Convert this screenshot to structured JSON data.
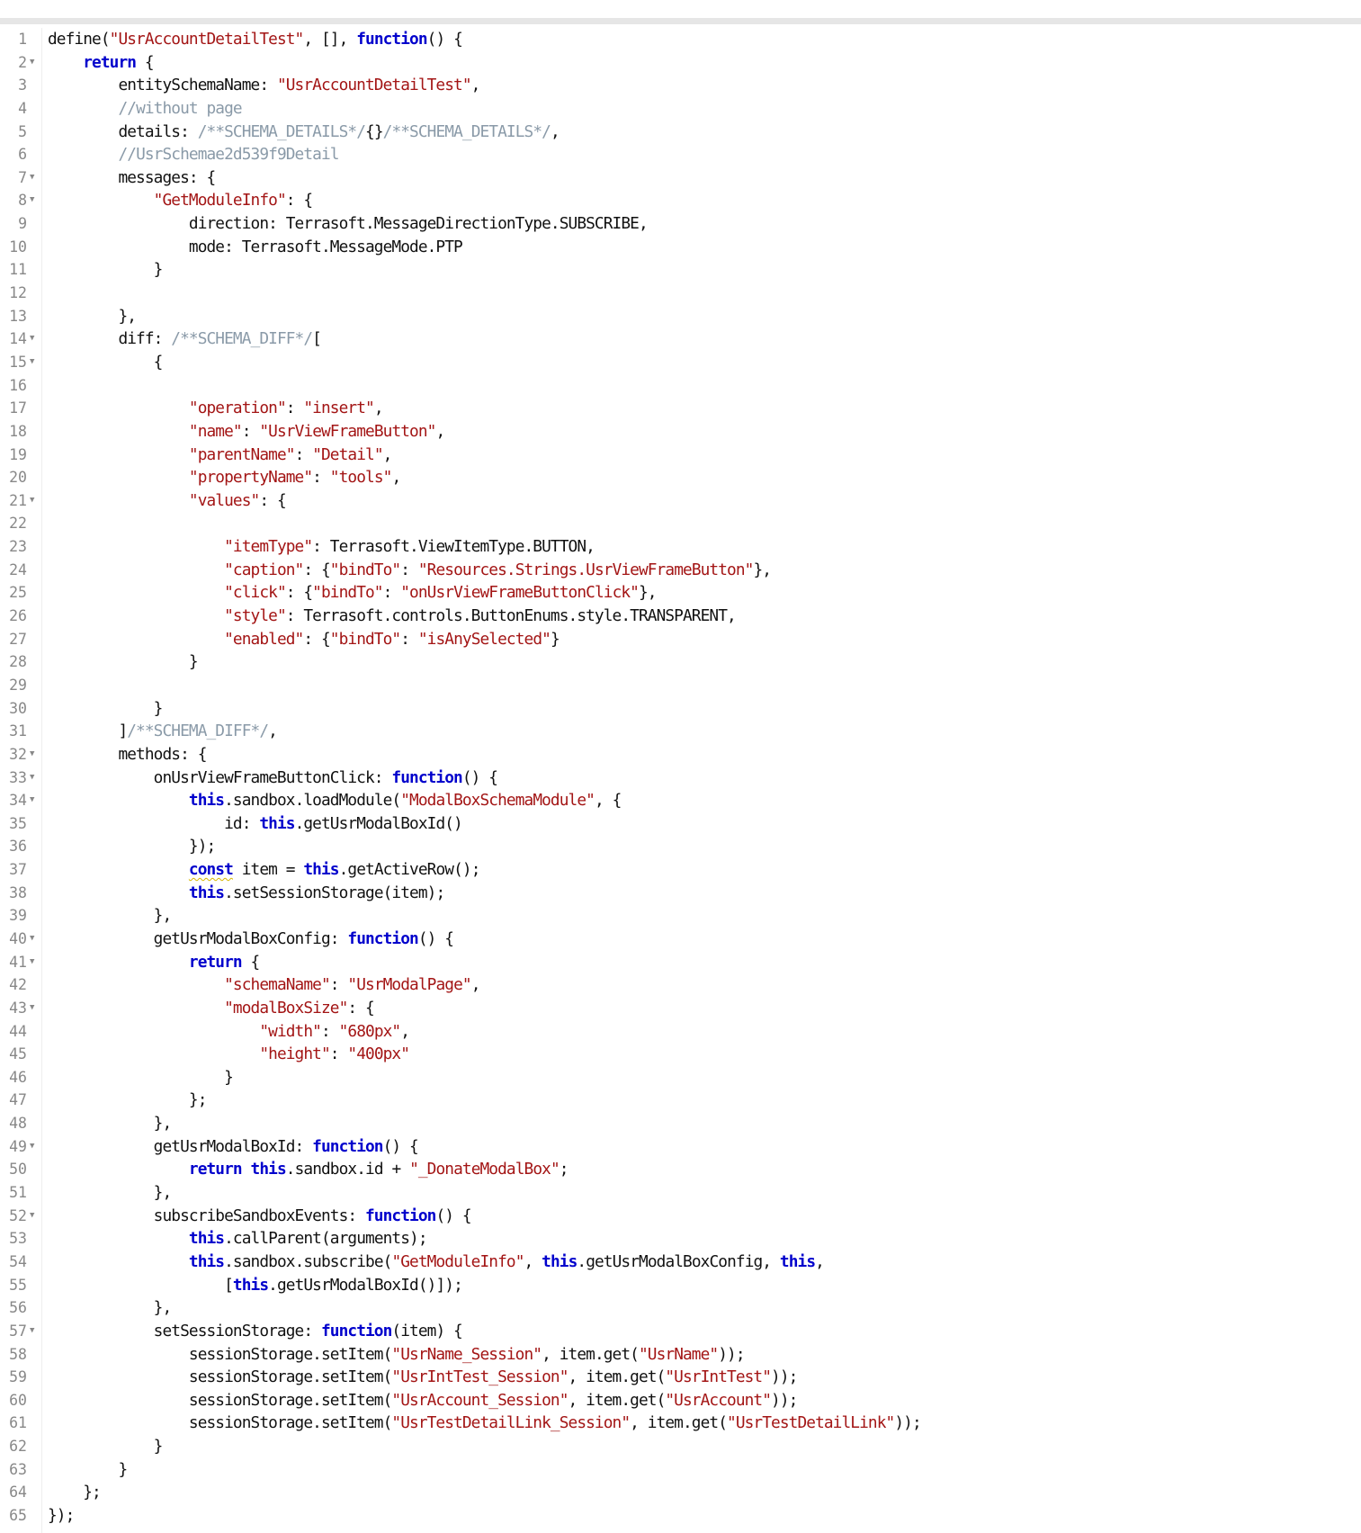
{
  "colors": {
    "keyword": "#0000cc",
    "string": "#a31515",
    "comment": "#8a9aa8",
    "text": "#111111",
    "line_number": "#888888",
    "top_bar": "#e6e6e6"
  },
  "lines": [
    {
      "n": "1",
      "fold": false,
      "tokens": [
        [
          "p",
          "define("
        ],
        [
          "s",
          "\"UsrAccountDetailTest\""
        ],
        [
          "p",
          ", [], "
        ],
        [
          "k",
          "function"
        ],
        [
          "p",
          "() {"
        ]
      ]
    },
    {
      "n": "2",
      "fold": true,
      "tokens": [
        [
          "p",
          "    "
        ],
        [
          "k",
          "return"
        ],
        [
          "p",
          " {"
        ]
      ]
    },
    {
      "n": "3",
      "fold": false,
      "tokens": [
        [
          "p",
          "        entitySchemaName: "
        ],
        [
          "s",
          "\"UsrAccountDetailTest\""
        ],
        [
          "p",
          ","
        ]
      ]
    },
    {
      "n": "4",
      "fold": false,
      "tokens": [
        [
          "p",
          "        "
        ],
        [
          "c",
          "//without page"
        ]
      ]
    },
    {
      "n": "5",
      "fold": false,
      "tokens": [
        [
          "p",
          "        details: "
        ],
        [
          "c",
          "/**SCHEMA_DETAILS*/"
        ],
        [
          "p",
          "{}"
        ],
        [
          "c",
          "/**SCHEMA_DETAILS*/"
        ],
        [
          "p",
          ","
        ]
      ]
    },
    {
      "n": "6",
      "fold": false,
      "tokens": [
        [
          "p",
          "        "
        ],
        [
          "c",
          "//UsrSchemae2d539f9Detail"
        ]
      ]
    },
    {
      "n": "7",
      "fold": true,
      "tokens": [
        [
          "p",
          "        messages: {"
        ]
      ]
    },
    {
      "n": "8",
      "fold": true,
      "tokens": [
        [
          "p",
          "            "
        ],
        [
          "s",
          "\"GetModuleInfo\""
        ],
        [
          "p",
          ": {"
        ]
      ]
    },
    {
      "n": "9",
      "fold": false,
      "tokens": [
        [
          "p",
          "                direction: Terrasoft.MessageDirectionType.SUBSCRIBE,"
        ]
      ]
    },
    {
      "n": "10",
      "fold": false,
      "tokens": [
        [
          "p",
          "                mode: Terrasoft.MessageMode.PTP"
        ]
      ]
    },
    {
      "n": "11",
      "fold": false,
      "tokens": [
        [
          "p",
          "            }"
        ]
      ]
    },
    {
      "n": "12",
      "fold": false,
      "tokens": [
        [
          "p",
          ""
        ]
      ]
    },
    {
      "n": "13",
      "fold": false,
      "tokens": [
        [
          "p",
          "        },"
        ]
      ]
    },
    {
      "n": "14",
      "fold": true,
      "tokens": [
        [
          "p",
          "        diff: "
        ],
        [
          "c",
          "/**SCHEMA_DIFF*/"
        ],
        [
          "p",
          "["
        ]
      ]
    },
    {
      "n": "15",
      "fold": true,
      "tokens": [
        [
          "p",
          "            {"
        ]
      ]
    },
    {
      "n": "16",
      "fold": false,
      "tokens": [
        [
          "p",
          ""
        ]
      ]
    },
    {
      "n": "17",
      "fold": false,
      "tokens": [
        [
          "p",
          "                "
        ],
        [
          "s",
          "\"operation\""
        ],
        [
          "p",
          ": "
        ],
        [
          "s",
          "\"insert\""
        ],
        [
          "p",
          ","
        ]
      ]
    },
    {
      "n": "18",
      "fold": false,
      "tokens": [
        [
          "p",
          "                "
        ],
        [
          "s",
          "\"name\""
        ],
        [
          "p",
          ": "
        ],
        [
          "s",
          "\"UsrViewFrameButton\""
        ],
        [
          "p",
          ","
        ]
      ]
    },
    {
      "n": "19",
      "fold": false,
      "tokens": [
        [
          "p",
          "                "
        ],
        [
          "s",
          "\"parentName\""
        ],
        [
          "p",
          ": "
        ],
        [
          "s",
          "\"Detail\""
        ],
        [
          "p",
          ","
        ]
      ]
    },
    {
      "n": "20",
      "fold": false,
      "tokens": [
        [
          "p",
          "                "
        ],
        [
          "s",
          "\"propertyName\""
        ],
        [
          "p",
          ": "
        ],
        [
          "s",
          "\"tools\""
        ],
        [
          "p",
          ","
        ]
      ]
    },
    {
      "n": "21",
      "fold": true,
      "tokens": [
        [
          "p",
          "                "
        ],
        [
          "s",
          "\"values\""
        ],
        [
          "p",
          ": {"
        ]
      ]
    },
    {
      "n": "22",
      "fold": false,
      "tokens": [
        [
          "p",
          ""
        ]
      ]
    },
    {
      "n": "23",
      "fold": false,
      "tokens": [
        [
          "p",
          "                    "
        ],
        [
          "s",
          "\"itemType\""
        ],
        [
          "p",
          ": Terrasoft.ViewItemType.BUTTON,"
        ]
      ]
    },
    {
      "n": "24",
      "fold": false,
      "tokens": [
        [
          "p",
          "                    "
        ],
        [
          "s",
          "\"caption\""
        ],
        [
          "p",
          ": {"
        ],
        [
          "s",
          "\"bindTo\""
        ],
        [
          "p",
          ": "
        ],
        [
          "s",
          "\"Resources.Strings.UsrViewFrameButton\""
        ],
        [
          "p",
          "},"
        ]
      ]
    },
    {
      "n": "25",
      "fold": false,
      "tokens": [
        [
          "p",
          "                    "
        ],
        [
          "s",
          "\"click\""
        ],
        [
          "p",
          ": {"
        ],
        [
          "s",
          "\"bindTo\""
        ],
        [
          "p",
          ": "
        ],
        [
          "s",
          "\"onUsrViewFrameButtonClick\""
        ],
        [
          "p",
          "},"
        ]
      ]
    },
    {
      "n": "26",
      "fold": false,
      "tokens": [
        [
          "p",
          "                    "
        ],
        [
          "s",
          "\"style\""
        ],
        [
          "p",
          ": Terrasoft.controls.ButtonEnums.style.TRANSPARENT,"
        ]
      ]
    },
    {
      "n": "27",
      "fold": false,
      "tokens": [
        [
          "p",
          "                    "
        ],
        [
          "s",
          "\"enabled\""
        ],
        [
          "p",
          ": {"
        ],
        [
          "s",
          "\"bindTo\""
        ],
        [
          "p",
          ": "
        ],
        [
          "s",
          "\"isAnySelected\""
        ],
        [
          "p",
          "}"
        ]
      ]
    },
    {
      "n": "28",
      "fold": false,
      "tokens": [
        [
          "p",
          "                }"
        ]
      ]
    },
    {
      "n": "29",
      "fold": false,
      "tokens": [
        [
          "p",
          ""
        ]
      ]
    },
    {
      "n": "30",
      "fold": false,
      "tokens": [
        [
          "p",
          "            }"
        ]
      ]
    },
    {
      "n": "31",
      "fold": false,
      "tokens": [
        [
          "p",
          "        ]"
        ],
        [
          "c",
          "/**SCHEMA_DIFF*/"
        ],
        [
          "p",
          ","
        ]
      ]
    },
    {
      "n": "32",
      "fold": true,
      "tokens": [
        [
          "p",
          "        methods: {"
        ]
      ]
    },
    {
      "n": "33",
      "fold": true,
      "tokens": [
        [
          "p",
          "            onUsrViewFrameButtonClick: "
        ],
        [
          "k",
          "function"
        ],
        [
          "p",
          "() {"
        ]
      ]
    },
    {
      "n": "34",
      "fold": true,
      "tokens": [
        [
          "p",
          "                "
        ],
        [
          "k",
          "this"
        ],
        [
          "p",
          ".sandbox.loadModule("
        ],
        [
          "s",
          "\"ModalBoxSchemaModule\""
        ],
        [
          "p",
          ", {"
        ]
      ]
    },
    {
      "n": "35",
      "fold": false,
      "tokens": [
        [
          "p",
          "                    id: "
        ],
        [
          "k",
          "this"
        ],
        [
          "p",
          ".getUsrModalBoxId()"
        ]
      ]
    },
    {
      "n": "36",
      "fold": false,
      "tokens": [
        [
          "p",
          "                });"
        ]
      ]
    },
    {
      "n": "37",
      "fold": false,
      "tokens": [
        [
          "p",
          "                "
        ],
        [
          "kc",
          "const"
        ],
        [
          "p",
          " item = "
        ],
        [
          "k",
          "this"
        ],
        [
          "p",
          ".getActiveRow();"
        ]
      ]
    },
    {
      "n": "38",
      "fold": false,
      "tokens": [
        [
          "p",
          "                "
        ],
        [
          "k",
          "this"
        ],
        [
          "p",
          ".setSessionStorage(item);"
        ]
      ]
    },
    {
      "n": "39",
      "fold": false,
      "tokens": [
        [
          "p",
          "            },"
        ]
      ]
    },
    {
      "n": "40",
      "fold": true,
      "tokens": [
        [
          "p",
          "            getUsrModalBoxConfig: "
        ],
        [
          "k",
          "function"
        ],
        [
          "p",
          "() {"
        ]
      ]
    },
    {
      "n": "41",
      "fold": true,
      "tokens": [
        [
          "p",
          "                "
        ],
        [
          "k",
          "return"
        ],
        [
          "p",
          " {"
        ]
      ]
    },
    {
      "n": "42",
      "fold": false,
      "tokens": [
        [
          "p",
          "                    "
        ],
        [
          "s",
          "\"schemaName\""
        ],
        [
          "p",
          ": "
        ],
        [
          "s",
          "\"UsrModalPage\""
        ],
        [
          "p",
          ","
        ]
      ]
    },
    {
      "n": "43",
      "fold": true,
      "tokens": [
        [
          "p",
          "                    "
        ],
        [
          "s",
          "\"modalBoxSize\""
        ],
        [
          "p",
          ": {"
        ]
      ]
    },
    {
      "n": "44",
      "fold": false,
      "tokens": [
        [
          "p",
          "                        "
        ],
        [
          "s",
          "\"width\""
        ],
        [
          "p",
          ": "
        ],
        [
          "s",
          "\"680px\""
        ],
        [
          "p",
          ","
        ]
      ]
    },
    {
      "n": "45",
      "fold": false,
      "tokens": [
        [
          "p",
          "                        "
        ],
        [
          "s",
          "\"height\""
        ],
        [
          "p",
          ": "
        ],
        [
          "s",
          "\"400px\""
        ]
      ]
    },
    {
      "n": "46",
      "fold": false,
      "tokens": [
        [
          "p",
          "                    }"
        ]
      ]
    },
    {
      "n": "47",
      "fold": false,
      "tokens": [
        [
          "p",
          "                };"
        ]
      ]
    },
    {
      "n": "48",
      "fold": false,
      "tokens": [
        [
          "p",
          "            },"
        ]
      ]
    },
    {
      "n": "49",
      "fold": true,
      "tokens": [
        [
          "p",
          "            getUsrModalBoxId: "
        ],
        [
          "k",
          "function"
        ],
        [
          "p",
          "() {"
        ]
      ]
    },
    {
      "n": "50",
      "fold": false,
      "tokens": [
        [
          "p",
          "                "
        ],
        [
          "k",
          "return"
        ],
        [
          "p",
          " "
        ],
        [
          "k",
          "this"
        ],
        [
          "p",
          ".sandbox.id + "
        ],
        [
          "s",
          "\"_DonateModalBox\""
        ],
        [
          "p",
          ";"
        ]
      ]
    },
    {
      "n": "51",
      "fold": false,
      "tokens": [
        [
          "p",
          "            },"
        ]
      ]
    },
    {
      "n": "52",
      "fold": true,
      "tokens": [
        [
          "p",
          "            subscribeSandboxEvents: "
        ],
        [
          "k",
          "function"
        ],
        [
          "p",
          "() {"
        ]
      ]
    },
    {
      "n": "53",
      "fold": false,
      "tokens": [
        [
          "p",
          "                "
        ],
        [
          "k",
          "this"
        ],
        [
          "p",
          ".callParent(arguments);"
        ]
      ]
    },
    {
      "n": "54",
      "fold": false,
      "tokens": [
        [
          "p",
          "                "
        ],
        [
          "k",
          "this"
        ],
        [
          "p",
          ".sandbox.subscribe("
        ],
        [
          "s",
          "\"GetModuleInfo\""
        ],
        [
          "p",
          ", "
        ],
        [
          "k",
          "this"
        ],
        [
          "p",
          ".getUsrModalBoxConfig, "
        ],
        [
          "k",
          "this"
        ],
        [
          "p",
          ","
        ]
      ]
    },
    {
      "n": "55",
      "fold": false,
      "tokens": [
        [
          "p",
          "                    ["
        ],
        [
          "k",
          "this"
        ],
        [
          "p",
          ".getUsrModalBoxId()]);"
        ]
      ]
    },
    {
      "n": "56",
      "fold": false,
      "tokens": [
        [
          "p",
          "            },"
        ]
      ]
    },
    {
      "n": "57",
      "fold": true,
      "tokens": [
        [
          "p",
          "            setSessionStorage: "
        ],
        [
          "k",
          "function"
        ],
        [
          "p",
          "(item) {"
        ]
      ]
    },
    {
      "n": "58",
      "fold": false,
      "tokens": [
        [
          "p",
          "                sessionStorage.setItem("
        ],
        [
          "s",
          "\"UsrName_Session\""
        ],
        [
          "p",
          ", item.get("
        ],
        [
          "s",
          "\"UsrName\""
        ],
        [
          "p",
          "));"
        ]
      ]
    },
    {
      "n": "59",
      "fold": false,
      "tokens": [
        [
          "p",
          "                sessionStorage.setItem("
        ],
        [
          "s",
          "\"UsrIntTest_Session\""
        ],
        [
          "p",
          ", item.get("
        ],
        [
          "s",
          "\"UsrIntTest\""
        ],
        [
          "p",
          "));"
        ]
      ]
    },
    {
      "n": "60",
      "fold": false,
      "tokens": [
        [
          "p",
          "                sessionStorage.setItem("
        ],
        [
          "s",
          "\"UsrAccount_Session\""
        ],
        [
          "p",
          ", item.get("
        ],
        [
          "s",
          "\"UsrAccount\""
        ],
        [
          "p",
          "));"
        ]
      ]
    },
    {
      "n": "61",
      "fold": false,
      "tokens": [
        [
          "p",
          "                sessionStorage.setItem("
        ],
        [
          "s",
          "\"UsrTestDetailLink_Session\""
        ],
        [
          "p",
          ", item.get("
        ],
        [
          "s",
          "\"UsrTestDetailLink\""
        ],
        [
          "p",
          "));"
        ]
      ]
    },
    {
      "n": "62",
      "fold": false,
      "tokens": [
        [
          "p",
          "            }"
        ]
      ]
    },
    {
      "n": "63",
      "fold": false,
      "tokens": [
        [
          "p",
          "        }"
        ]
      ]
    },
    {
      "n": "64",
      "fold": false,
      "tokens": [
        [
          "p",
          "    };"
        ]
      ]
    },
    {
      "n": "65",
      "fold": false,
      "tokens": [
        [
          "p",
          "});"
        ]
      ]
    }
  ]
}
